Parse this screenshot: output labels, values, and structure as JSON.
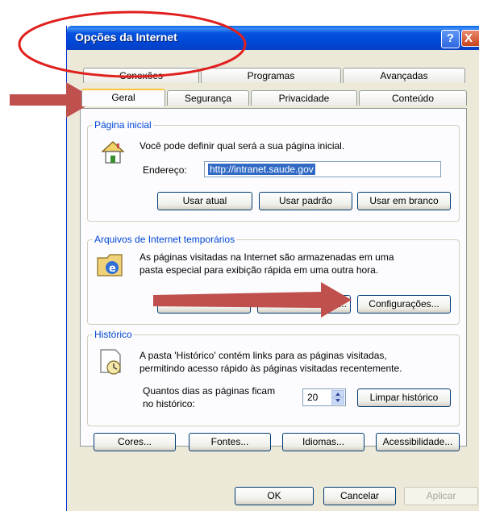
{
  "dialog": {
    "title": "Opções da Internet",
    "help_label": "?",
    "close_label": "X"
  },
  "tabs": {
    "conexoes": "Conexões",
    "programas": "Programas",
    "avancadas": "Avançadas",
    "geral": "Geral",
    "seguranca": "Segurança",
    "privacidade": "Privacidade",
    "conteudo": "Conteúdo"
  },
  "home_page": {
    "legend": "Página inicial",
    "description": "Você pode definir qual será a sua página inicial.",
    "address_label": "Endereço:",
    "address_value": "http://intranet.saude.gov",
    "use_current": "Usar atual",
    "use_default": "Usar padrão",
    "use_blank": "Usar em branco"
  },
  "temp_files": {
    "legend": "Arquivos de Internet temporários",
    "description_1": "As páginas visitadas na Internet são armazenadas em uma",
    "description_2": "pasta especial para exibição rápida em uma outra hora.",
    "delete_files_ellipsis": "...",
    "settings": "Configurações..."
  },
  "history": {
    "legend": "Histórico",
    "description_1": "A pasta 'Histórico' contém links para as páginas visitadas,",
    "description_2": "permitindo acesso rápido às páginas visitadas recentemente.",
    "days_label_1": "Quantos dias as páginas ficam",
    "days_label_2": "no histórico:",
    "days_value": "20",
    "clear": "Limpar histórico"
  },
  "bottom_buttons": {
    "colors": "Cores...",
    "fonts": "Fontes...",
    "languages": "Idiomas...",
    "accessibility": "Acessibilidade..."
  },
  "dialog_buttons": {
    "ok": "OK",
    "cancel": "Cancelar",
    "apply": "Aplicar"
  },
  "colors": {
    "annotation_red": "#C0504D",
    "titlebar_blue": "#0054E3",
    "group_legend": "#0046D5"
  }
}
